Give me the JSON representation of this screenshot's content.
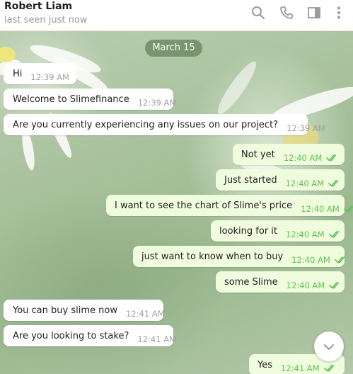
{
  "header": {
    "name": "Robert Liam",
    "status": "last seen just now",
    "icons": [
      "search-icon",
      "phone-icon",
      "sidebar-icon",
      "more-icon"
    ]
  },
  "date_label": "March 15",
  "messages": [
    {
      "dir": "in",
      "text": "Hi",
      "time": "12:39 AM"
    },
    {
      "dir": "in",
      "text": "Welcome to Slimefinance",
      "time": "12:39 AM"
    },
    {
      "dir": "in",
      "text": "Are you currently experiencing any issues on our project?",
      "time": "12:39 AM"
    },
    {
      "dir": "out",
      "text": "Not yet",
      "time": "12:40 AM",
      "read": true
    },
    {
      "dir": "out",
      "text": "Just started",
      "time": "12:40 AM",
      "read": true
    },
    {
      "dir": "out",
      "text": "I want to see the chart of Slime's price",
      "time": "12:40 AM",
      "read": true
    },
    {
      "dir": "out",
      "text": "looking for it",
      "time": "12:40 AM",
      "read": true
    },
    {
      "dir": "out",
      "text": "just want to know when to buy",
      "time": "12:40 AM",
      "read": true
    },
    {
      "dir": "out",
      "text": "some Slime",
      "time": "12:40 AM",
      "read": true
    },
    {
      "dir": "in",
      "text": "You can buy slime now",
      "time": "12:41 AM"
    },
    {
      "dir": "in",
      "text": "Are you looking to stake?",
      "time": "12:41 AM"
    },
    {
      "dir": "out",
      "text": "Yes",
      "time": "12:41 AM",
      "read": true
    }
  ],
  "colors": {
    "incoming_bubble": "#ffffff",
    "outgoing_bubble": "#effdde",
    "read_ticks": "#5dc251",
    "date_pill": "#6e8c64"
  }
}
